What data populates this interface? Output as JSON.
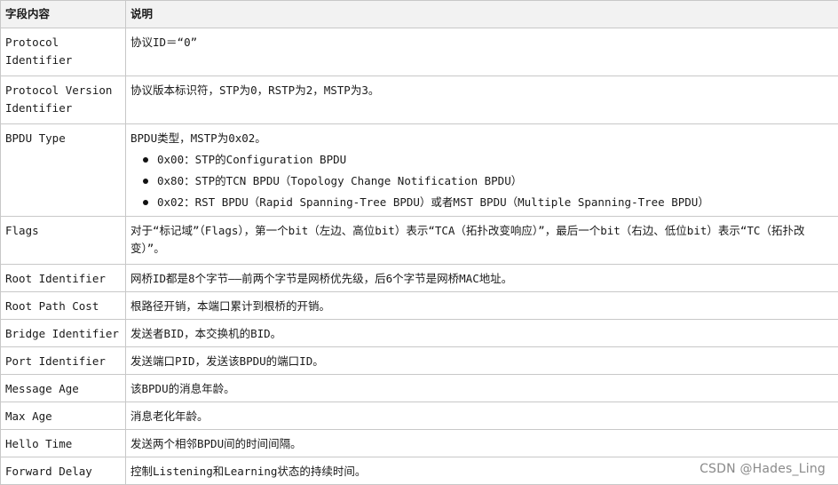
{
  "table": {
    "headers": [
      "字段内容",
      "说明"
    ],
    "rows": [
      {
        "field": "Protocol Identifier",
        "desc": "协议ID＝“0”"
      },
      {
        "field": "Protocol Version Identifier",
        "desc": "协议版本标识符，STP为0，RSTP为2，MSTP为3。"
      },
      {
        "field": "BPDU Type",
        "desc": "BPDU类型，MSTP为0x02。",
        "bullets": [
          "0x00：STP的Configuration BPDU",
          "0x80：STP的TCN BPDU（Topology Change Notification BPDU）",
          "0x02：RST BPDU（Rapid Spanning-Tree BPDU）或者MST BPDU（Multiple Spanning-Tree BPDU）"
        ]
      },
      {
        "field": "Flags",
        "desc": "对于“标记域”（Flags），第一个bit（左边、高位bit）表示“TCA（拓扑改变响应）”，最后一个bit（右边、低位bit）表示“TC（拓扑改变）”。"
      },
      {
        "field": "Root Identifier",
        "desc": "网桥ID都是8个字节——前两个字节是网桥优先级，后6个字节是网桥MAC地址。"
      },
      {
        "field": "Root Path Cost",
        "desc": "根路径开销，本端口累计到根桥的开销。"
      },
      {
        "field": "Bridge Identifier",
        "desc": "发送者BID，本交换机的BID。"
      },
      {
        "field": "Port Identifier",
        "desc": "发送端口PID，发送该BPDU的端口ID。"
      },
      {
        "field": "Message Age",
        "desc": "该BPDU的消息年龄。"
      },
      {
        "field": "Max Age",
        "desc": "消息老化年龄。"
      },
      {
        "field": "Hello Time",
        "desc": "发送两个相邻BPDU间的时间间隔。"
      },
      {
        "field": "Forward Delay",
        "desc": "控制Listening和Learning状态的持续时间。"
      }
    ]
  },
  "watermark": "CSDN @Hades_Ling"
}
